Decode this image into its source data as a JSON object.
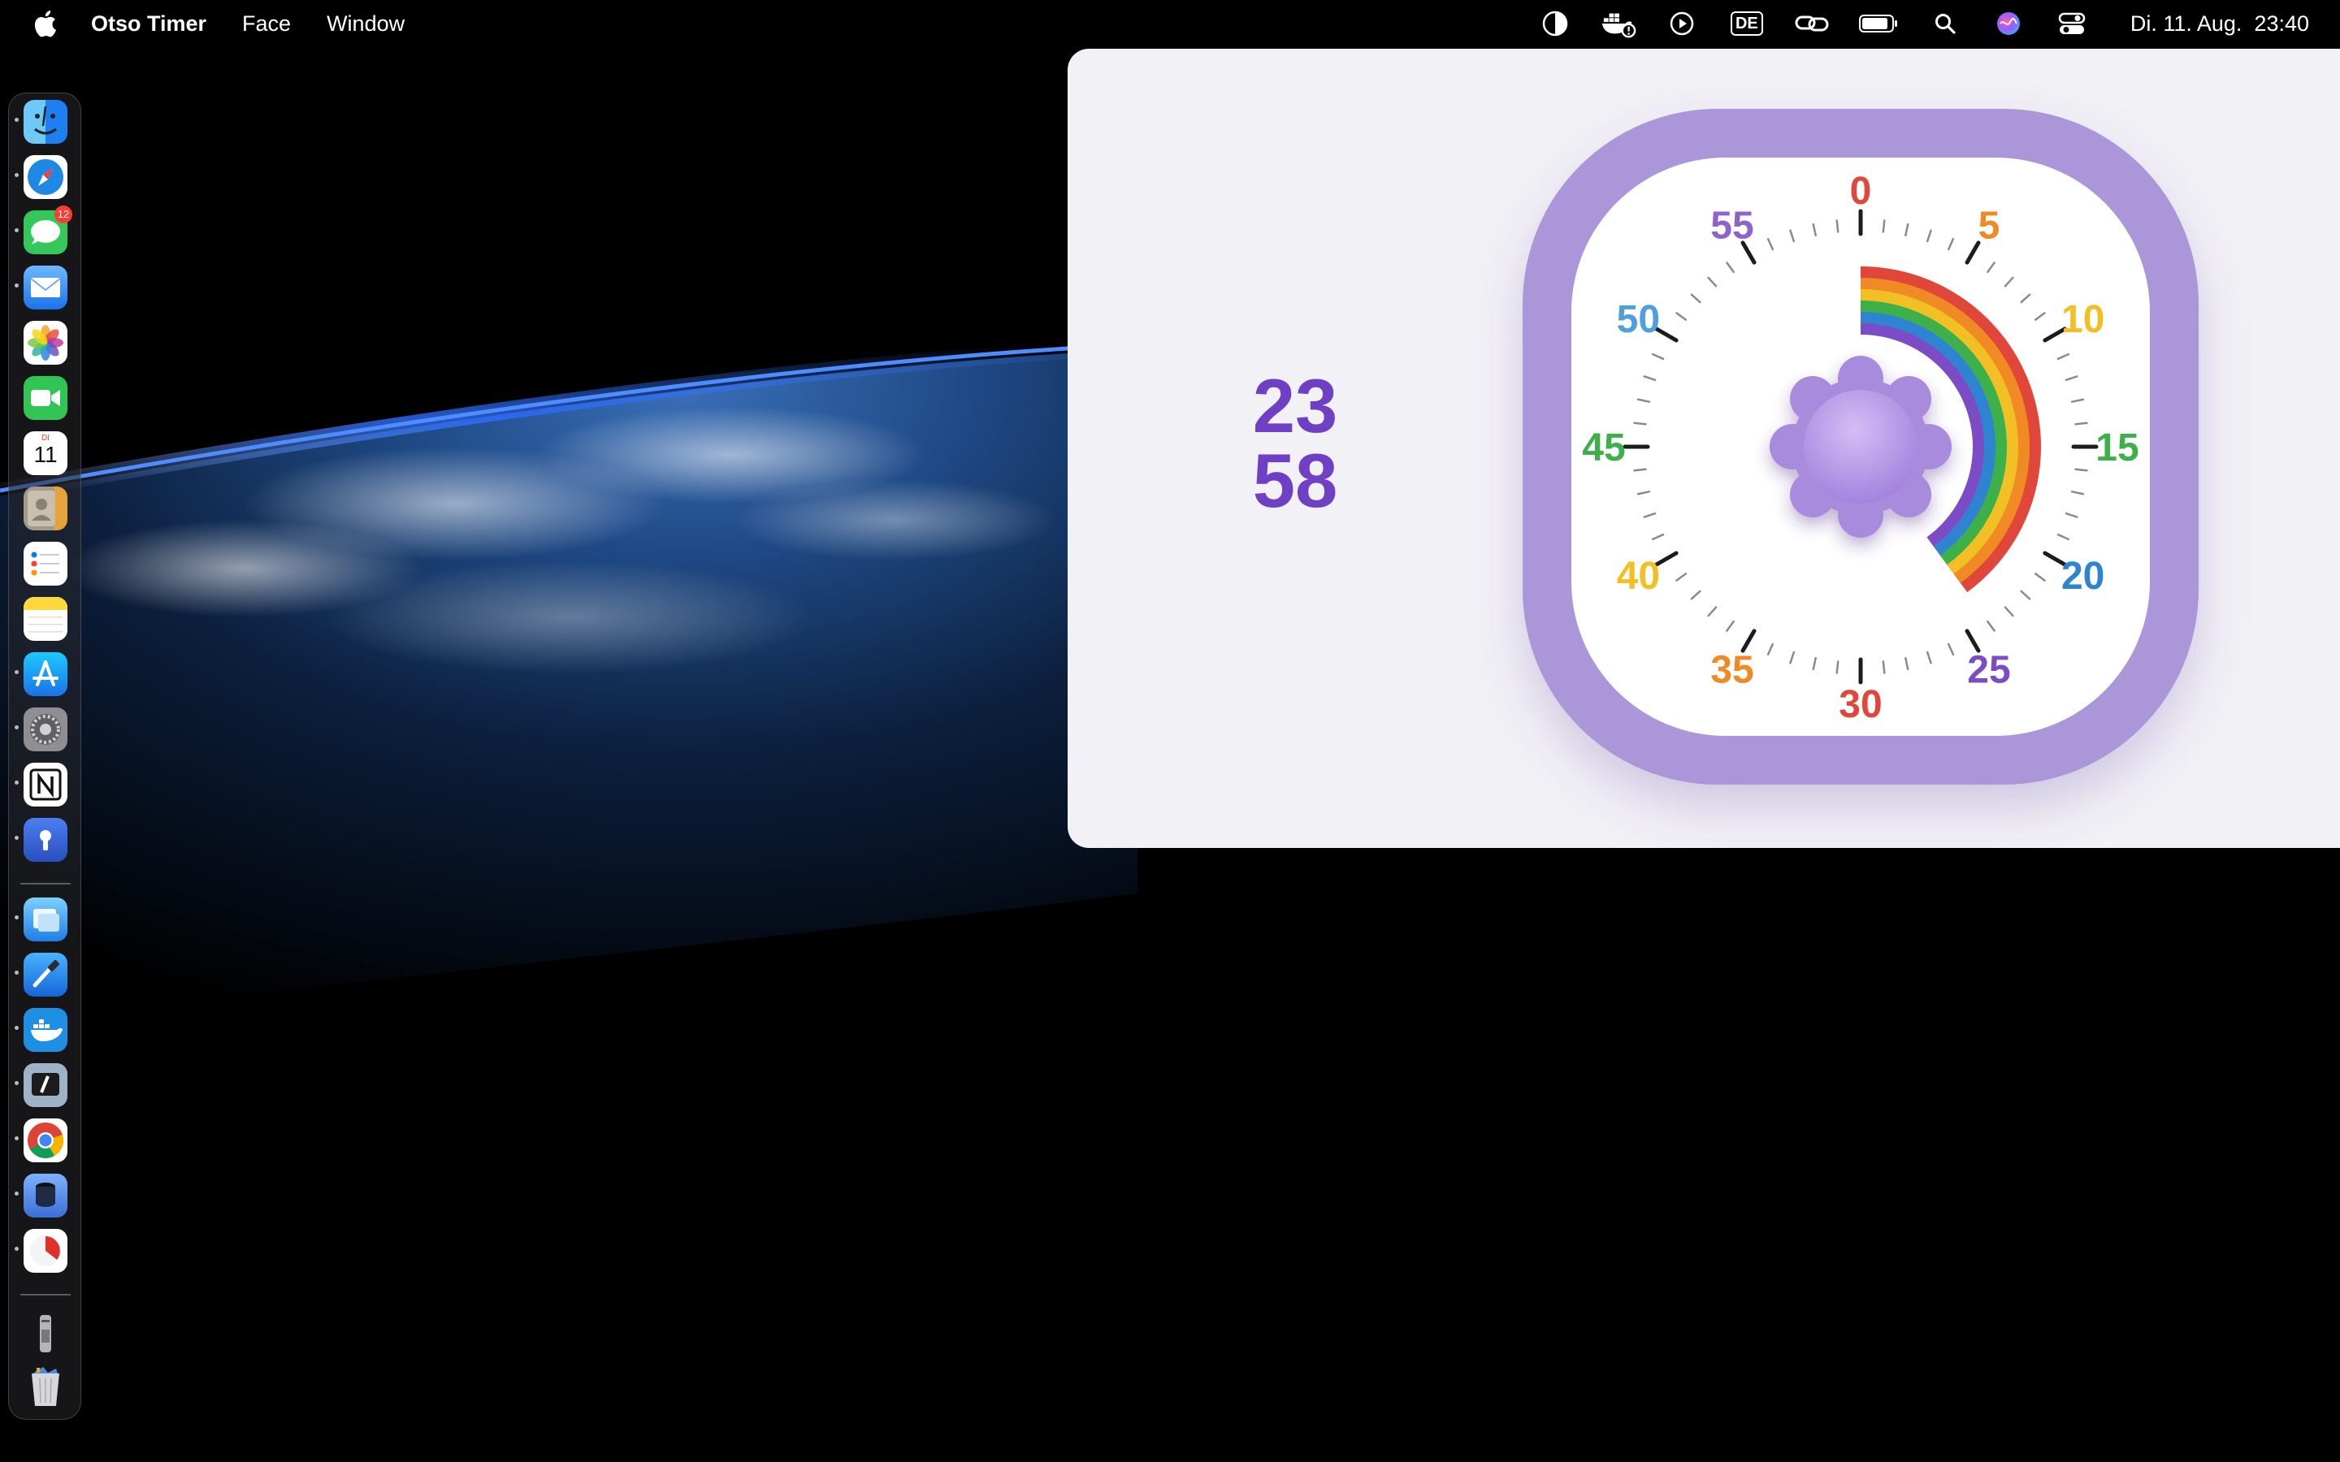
{
  "menubar": {
    "app_name": "Otso Timer",
    "menus": [
      "Face",
      "Window"
    ],
    "clock": "Di. 11. Aug.  23:40",
    "keyboard_layout": "DE",
    "status_icons": [
      "appearance-icon",
      "docker-whale-icon",
      "play-circle-icon",
      "keyboard-layout-icon",
      "link-icon",
      "battery-icon",
      "search-icon",
      "siri-icon",
      "control-center-icon"
    ]
  },
  "dock": {
    "apps": [
      {
        "name": "finder-icon",
        "color": "#2a9df4"
      },
      {
        "name": "safari-icon",
        "color": "#1e88e5"
      },
      {
        "name": "messages-icon",
        "color": "#34c759",
        "badge": "12"
      },
      {
        "name": "mail-icon",
        "color": "#3b8cf5"
      },
      {
        "name": "photos-icon",
        "color": "#ffffff"
      },
      {
        "name": "facetime-icon",
        "color": "#31c653"
      },
      {
        "name": "calendar-icon",
        "color": "#ffffff",
        "day": "11",
        "weekday": "DI"
      },
      {
        "name": "contacts-icon",
        "color": "#c9b89b"
      },
      {
        "name": "reminders-icon",
        "color": "#ffffff"
      },
      {
        "name": "notes-icon",
        "color": "#ffd93b"
      },
      {
        "name": "app-store-icon",
        "color": "#1a8cf5"
      },
      {
        "name": "system-settings-icon",
        "color": "#8e8e93"
      },
      {
        "name": "notion-icon",
        "color": "#ffffff"
      },
      {
        "name": "password-manager-icon",
        "color": "#3761d7"
      },
      {
        "name": "files-app-icon",
        "color": "#3fa3f5"
      },
      {
        "name": "xcode-icon",
        "color": "#1c8ef0"
      },
      {
        "name": "docker-icon",
        "color": "#1d90e5"
      },
      {
        "name": "dark-app-icon",
        "color": "#9fb3c8"
      },
      {
        "name": "chrome-icon",
        "color": "#ffffff"
      },
      {
        "name": "database-app-icon",
        "color": "#4b87e8"
      },
      {
        "name": "timer-app-icon",
        "color": "#ffffff"
      },
      {
        "name": "downloads-stack-icon",
        "color": "#9a9a9a"
      },
      {
        "name": "trash-icon",
        "color": "#c8c8cc"
      }
    ]
  },
  "timer": {
    "remaining_minutes": "23",
    "remaining_seconds": "58",
    "remaining_fraction_of_hour": 0.3994,
    "frame_color": "#ab96d9",
    "knob_color": "#b79be4",
    "dial_labels": [
      {
        "text": "0",
        "color": "#e0463a"
      },
      {
        "text": "5",
        "color": "#ef8a25"
      },
      {
        "text": "10",
        "color": "#f2c025"
      },
      {
        "text": "15",
        "color": "#3db04a"
      },
      {
        "text": "20",
        "color": "#2f84d2"
      },
      {
        "text": "25",
        "color": "#7b4cc6"
      },
      {
        "text": "30",
        "color": "#e0463a"
      },
      {
        "text": "35",
        "color": "#ef8a25"
      },
      {
        "text": "40",
        "color": "#f2c025"
      },
      {
        "text": "45",
        "color": "#3db04a"
      },
      {
        "text": "50",
        "color": "#4f9ede"
      },
      {
        "text": "55",
        "color": "#8e63cc"
      }
    ],
    "rainbow_colors": [
      "#e0463a",
      "#ef8a25",
      "#f2c025",
      "#3db04a",
      "#2f84d2",
      "#7b4cc6"
    ]
  }
}
